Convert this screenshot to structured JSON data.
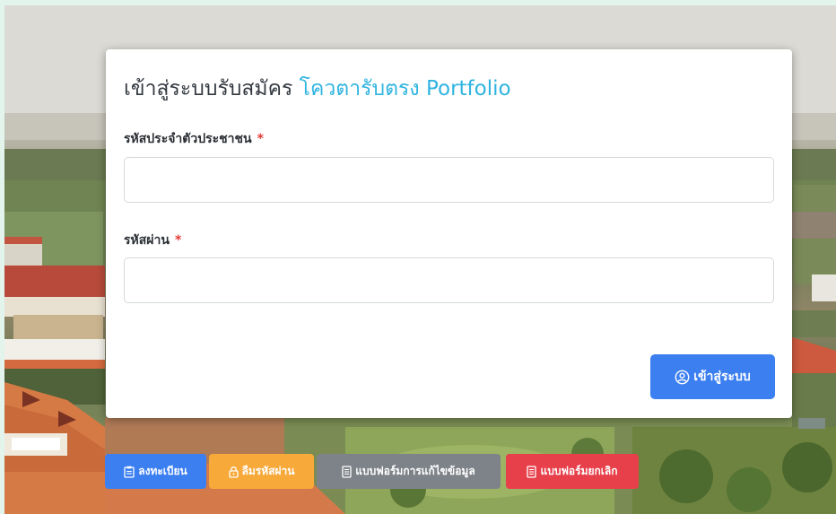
{
  "login": {
    "title_prefix": "เข้าสู่ระบบรับสมัคร",
    "title_accent": "โควตารับตรง Portfolio",
    "id_label": "รหัสประจำตัวประชาชน",
    "id_value": "",
    "password_label": "รหัสผ่าน",
    "password_value": "",
    "required_mark": "*",
    "submit_label": "เข้าสู่ระบบ"
  },
  "actions": {
    "register_label": "ลงทะเบียน",
    "forgot_label": "ลืมรหัสผ่าน",
    "edit_form_label": "แบบฟอร์มการแก้ไขข้อมูล",
    "cancel_form_label": "แบบฟอร์มยกเลิก"
  },
  "colors": {
    "accent": "#2fb4e0",
    "primary": "#3c7ff0",
    "warning": "#f7a93a",
    "secondary": "#7e8389",
    "danger": "#e7404b",
    "required": "#e53935"
  },
  "icons": {
    "submit": "user-circle-icon",
    "register": "clipboard-icon",
    "forgot": "lock-icon",
    "edit_form": "document-icon",
    "cancel_form": "document-icon"
  }
}
